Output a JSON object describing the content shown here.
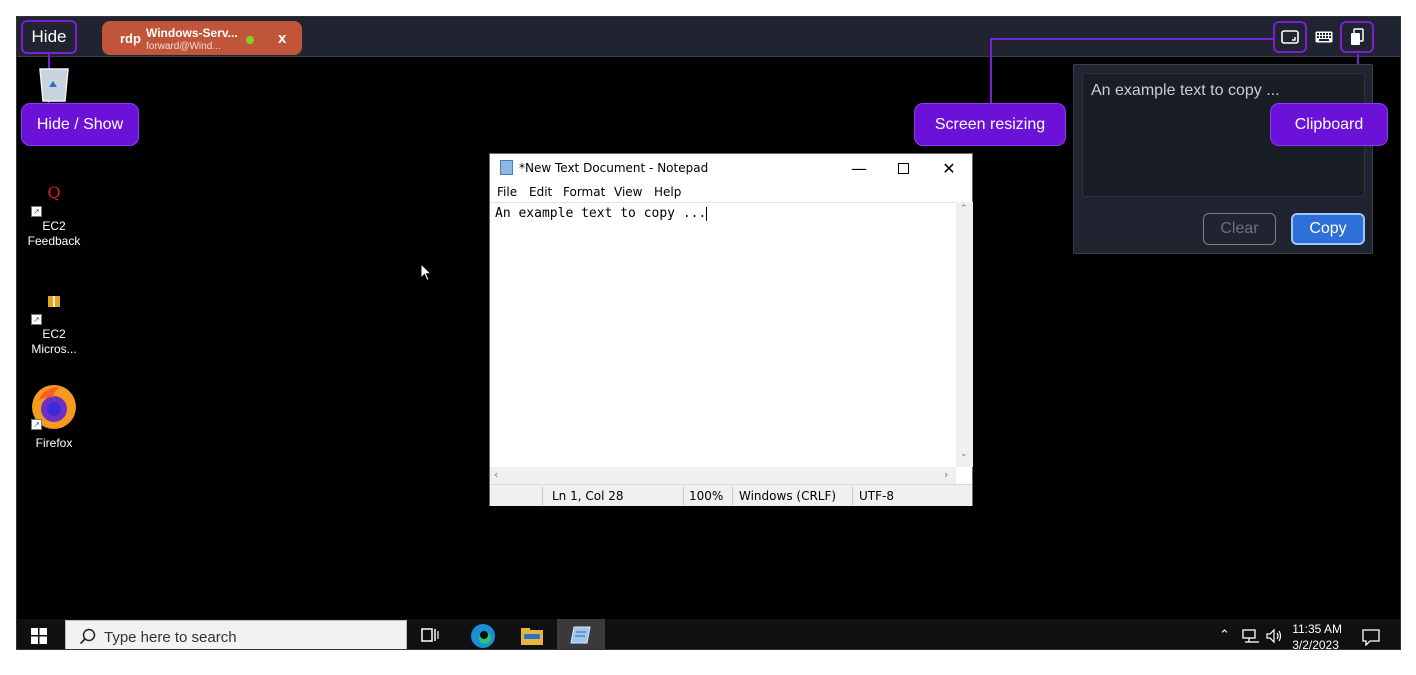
{
  "toolbar": {
    "hide_label": "Hide",
    "session": {
      "protocol": "rdp",
      "name": "Windows-Serv...",
      "user": "forward@Wind...",
      "close": "x"
    }
  },
  "callouts": {
    "hide_show": "Hide / Show",
    "screen_resizing": "Screen resizing",
    "clipboard": "Clipboard"
  },
  "clipboard_panel": {
    "text": "An example text to copy ...",
    "clear_label": "Clear",
    "copy_label": "Copy"
  },
  "desktop_icons": [
    {
      "label": "",
      "icon": "recycle-bin-icon"
    },
    {
      "label": "EC2 Feedback",
      "icon": "ec2-feedback-icon"
    },
    {
      "label": "EC2\nMicros...",
      "icon": "ec2-microsoft-icon"
    },
    {
      "label": "Firefox",
      "icon": "firefox-icon"
    }
  ],
  "notepad": {
    "title": "*New Text Document - Notepad",
    "menu": [
      "File",
      "Edit",
      "Format",
      "View",
      "Help"
    ],
    "content": "An example text to copy ...",
    "status": {
      "position": "Ln 1, Col 28",
      "zoom": "100%",
      "line_endings": "Windows (CRLF)",
      "encoding": "UTF-8"
    }
  },
  "taskbar": {
    "search_placeholder": "Type here to search",
    "time": "11:35 AM",
    "date": "3/2/2023"
  },
  "colors": {
    "accent_purple": "#6b11d8",
    "session_tab": "#c0553a",
    "copy_button": "#2f6fd8",
    "toolbar_bg": "#1f2430"
  }
}
